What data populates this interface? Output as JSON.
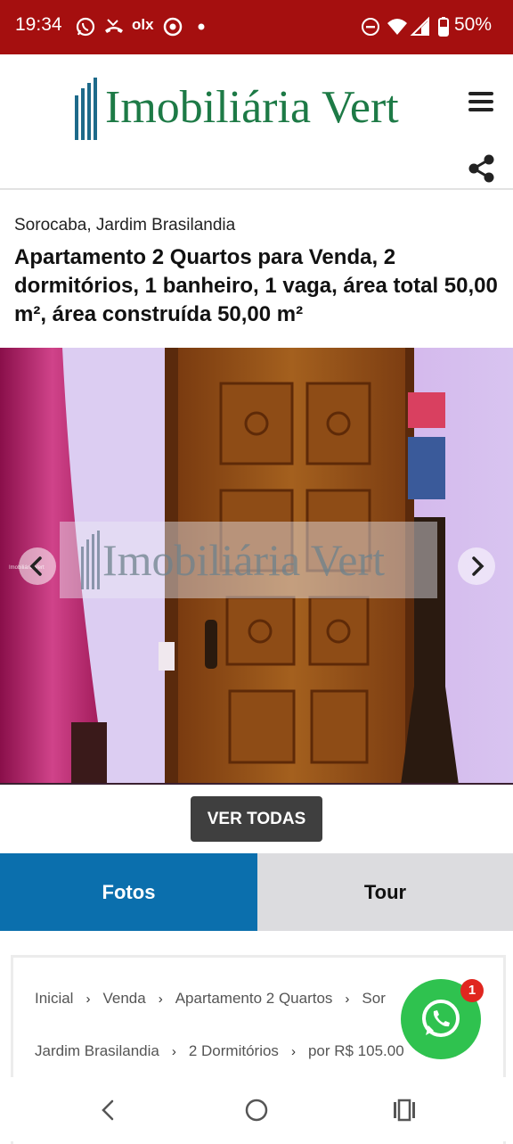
{
  "status_bar": {
    "time": "19:34",
    "olx_label": "olx",
    "battery": "50%",
    "icons": [
      "whatsapp-icon",
      "missed-call-icon",
      "olx-icon",
      "chrome-icon",
      "dot-icon",
      "dnd-icon",
      "wifi-icon",
      "signal-icon",
      "battery-icon"
    ]
  },
  "header": {
    "logo_text": "Imobiliária Vert",
    "menu_icon": "hamburger-menu-icon",
    "share_icon": "share-icon"
  },
  "listing": {
    "location": "Sorocaba, Jardim Brasilandia",
    "title": "Apartamento 2 Quartos para Venda, 2 dormitórios, 1 banheiro, 1 vaga, área total 50,00 m², área construída 50,00 m²"
  },
  "gallery": {
    "watermark": "Imobiliária Vert",
    "small_watermark": "Imobiliária Vert",
    "view_all_label": "VER TODAS"
  },
  "tabs": [
    {
      "label": "Fotos",
      "active": true
    },
    {
      "label": "Tour",
      "active": false
    }
  ],
  "breadcrumb": {
    "row1": [
      "Inicial",
      "Venda",
      "Apartamento 2 Quartos",
      "Sor"
    ],
    "row2": [
      "Jardim Brasilandia",
      "2 Dormitórios",
      "por R$ 105.00"
    ]
  },
  "whatsapp": {
    "badge": "1"
  },
  "colors": {
    "status_bar": "#a50f0f",
    "logo_green": "#1d7a46",
    "tab_active": "#0b6fad",
    "tab_inactive": "#dcdcdf",
    "whatsapp": "#2fc24f",
    "badge": "#e0261f"
  }
}
